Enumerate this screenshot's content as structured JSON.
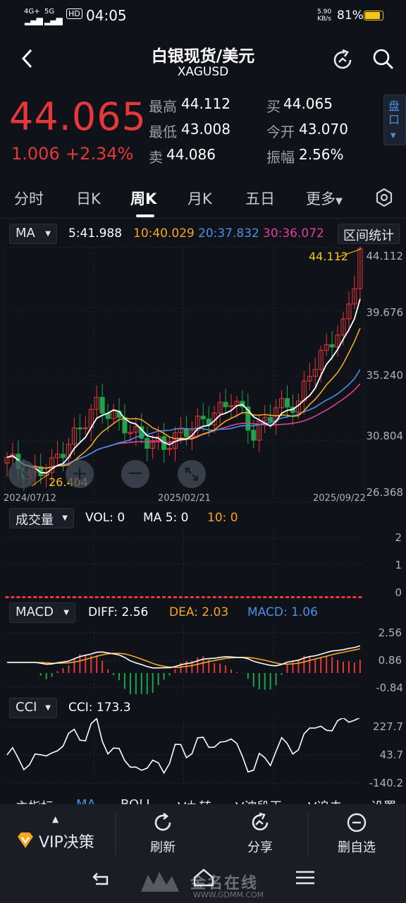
{
  "status_bar": {
    "net1": "4G+",
    "net2": "5G",
    "hd": "HD",
    "time": "04:05",
    "speed_value": "5.90",
    "speed_unit": "KB/s",
    "battery": "81%"
  },
  "header": {
    "title": "白银现货/美元",
    "symbol": "XAGUSD"
  },
  "quote": {
    "price": "44.065",
    "change": "1.006",
    "change_pct": "+2.34%",
    "high_label": "最高",
    "high": "44.112",
    "buy_label": "买",
    "buy": "44.065",
    "low_label": "最低",
    "low": "43.008",
    "open_label": "今开",
    "open": "43.070",
    "sell_label": "卖",
    "sell": "44.086",
    "amp_label": "振幅",
    "amp": "2.56%",
    "pankou": "盘口"
  },
  "tabs": {
    "items": [
      "分时",
      "日K",
      "周K",
      "月K",
      "五日",
      "更多"
    ],
    "active": "周K"
  },
  "ma": {
    "selector": "MA",
    "ma5": "5:41.988",
    "ma10": "10:40.029",
    "ma20": "20:37.832",
    "ma30": "30:36.072",
    "stats_button": "区间统计",
    "axis": [
      "44.112",
      "39.676",
      "35.240",
      "30.804",
      "26.368"
    ],
    "dates": [
      "2024/07/12",
      "2025/02/21",
      "2025/09/22"
    ],
    "high_mark": "44.112",
    "low_mark": "26.404",
    "colors": {
      "ma5": "#ffffff",
      "ma10": "#f5a623",
      "ma20": "#4a90e2",
      "ma30": "#e23e9c",
      "up": "#e5383b",
      "down": "#1fa34a"
    }
  },
  "vol": {
    "selector": "成交量",
    "vol": "VOL: 0",
    "ma5": "MA 5: 0",
    "ma10": "10: 0",
    "axis": [
      "2",
      "1",
      "0"
    ]
  },
  "macd": {
    "selector": "MACD",
    "diff": "DIFF: 2.56",
    "dea": "DEA: 2.03",
    "macd": "MACD: 1.06",
    "axis": [
      "2.56",
      "0.86",
      "-0.84"
    ]
  },
  "cci": {
    "selector": "CCI",
    "value": "CCI: 173.3",
    "axis": [
      "227.7",
      "43.7",
      "-140.2"
    ]
  },
  "indicator_tabs": [
    "主指标",
    "MA",
    "BOLL",
    "V九转",
    "V波段王",
    "V追击",
    "设置"
  ],
  "bottom_nav": {
    "vip": "VIP决策",
    "refresh": "刷新",
    "share": "分享",
    "remove": "删自选"
  },
  "watermark": {
    "brand": "金名在线",
    "url": "WWW.GDMM.COM"
  }
}
